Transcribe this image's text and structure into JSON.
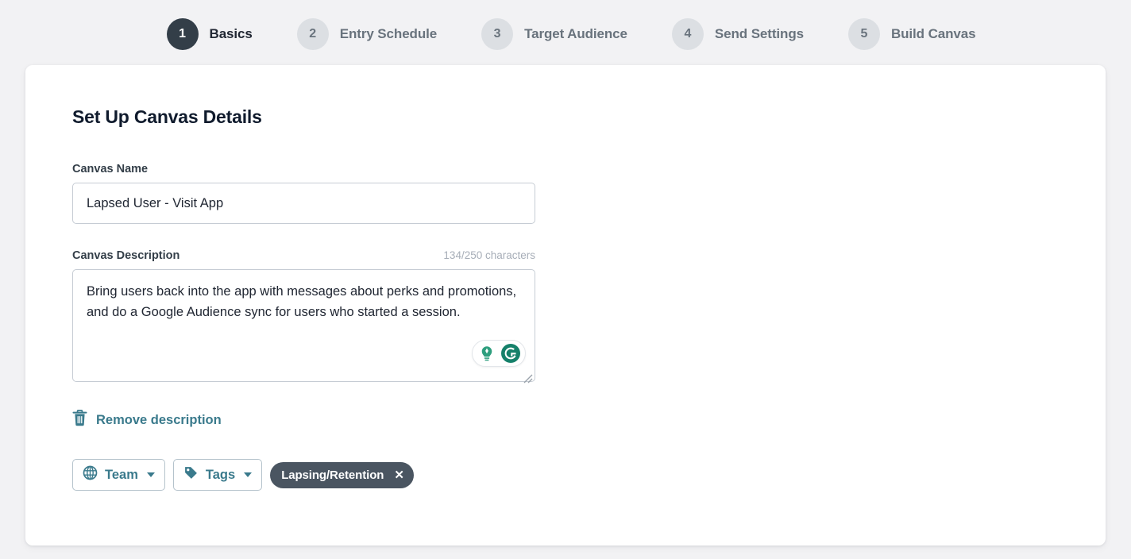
{
  "stepper": {
    "steps": [
      {
        "number": "1",
        "label": "Basics",
        "state": "active"
      },
      {
        "number": "2",
        "label": "Entry Schedule",
        "state": "inactive"
      },
      {
        "number": "3",
        "label": "Target Audience",
        "state": "inactive"
      },
      {
        "number": "4",
        "label": "Send Settings",
        "state": "inactive"
      },
      {
        "number": "5",
        "label": "Build Canvas",
        "state": "inactive"
      }
    ]
  },
  "card": {
    "title": "Set Up Canvas Details",
    "canvas_name": {
      "label": "Canvas Name",
      "value": "Lapsed User - Visit App",
      "placeholder": "Canvas Name"
    },
    "canvas_description": {
      "label": "Canvas Description",
      "counter": "134/250 characters",
      "value": "Bring users back into the app with messages about perks and promotions, and do a Google Audience sync for users who started a session.",
      "placeholder": "Canvas Description"
    },
    "remove_description": {
      "label": "Remove description",
      "icon": "trash-icon"
    },
    "controls": {
      "team": {
        "label": "Team",
        "icon": "globe-icon",
        "caret": "chevron-down-icon"
      },
      "tags": {
        "label": "Tags",
        "icon": "tag-icon",
        "caret": "chevron-down-icon"
      },
      "tag_chips": [
        {
          "label": "Lapsing/Retention",
          "close": "✕"
        }
      ]
    },
    "assistant": {
      "lightbulb": "lightbulb-icon",
      "grammarly": "grammarly-icon"
    }
  },
  "colors": {
    "page_background": "#f2f2f4",
    "card_background": "#ffffff",
    "active_step": "#333e48",
    "inactive_step": "#dcdfe3",
    "accent_teal": "#3a7a8c",
    "chip_background": "#4a5561",
    "input_border": "#c6ccd4",
    "muted_text": "#69737d",
    "counter_text": "#a7aeb8",
    "title_text": "#101b2d"
  }
}
